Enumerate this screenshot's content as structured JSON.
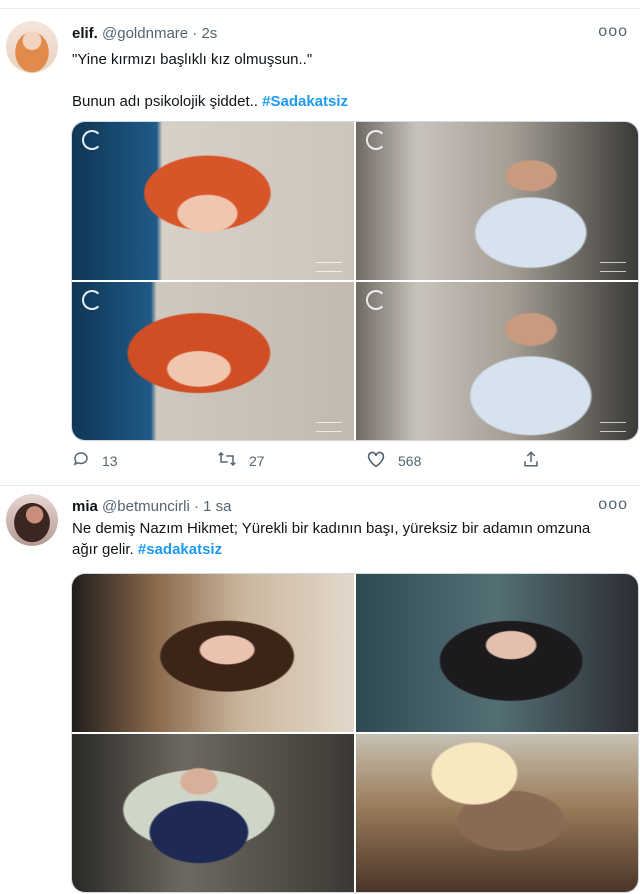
{
  "tweets": [
    {
      "name": "elif.",
      "handle": "@goldnmare",
      "sep": "·",
      "time": "2s",
      "more": "ooo",
      "line1": "\"Yine kırmızı başlıklı kız olmuşsun..\"",
      "line2_text": "Bunun adı psikolojik şiddet.. ",
      "hashtag": "#Sadakatsiz",
      "stats": {
        "replies": "13",
        "retweets": "27",
        "likes": "568"
      }
    },
    {
      "name": "mia",
      "handle": "@betmuncirli",
      "sep": "·",
      "time": "1 sa",
      "more": "ooo",
      "text": "Ne demiş Nazım Hikmet; Yürekli bir kadının başı, yüreksiz bir adamın omzuna ağır gelir. ",
      "hashtag": "#sadakatsiz"
    }
  ],
  "icons": {
    "reply": "reply-icon",
    "retweet": "retweet-icon",
    "like": "heart-icon",
    "share": "share-icon"
  },
  "colors": {
    "accent": "#1d9bf0",
    "secondary_text": "#536471",
    "border": "#e6ecf0"
  }
}
